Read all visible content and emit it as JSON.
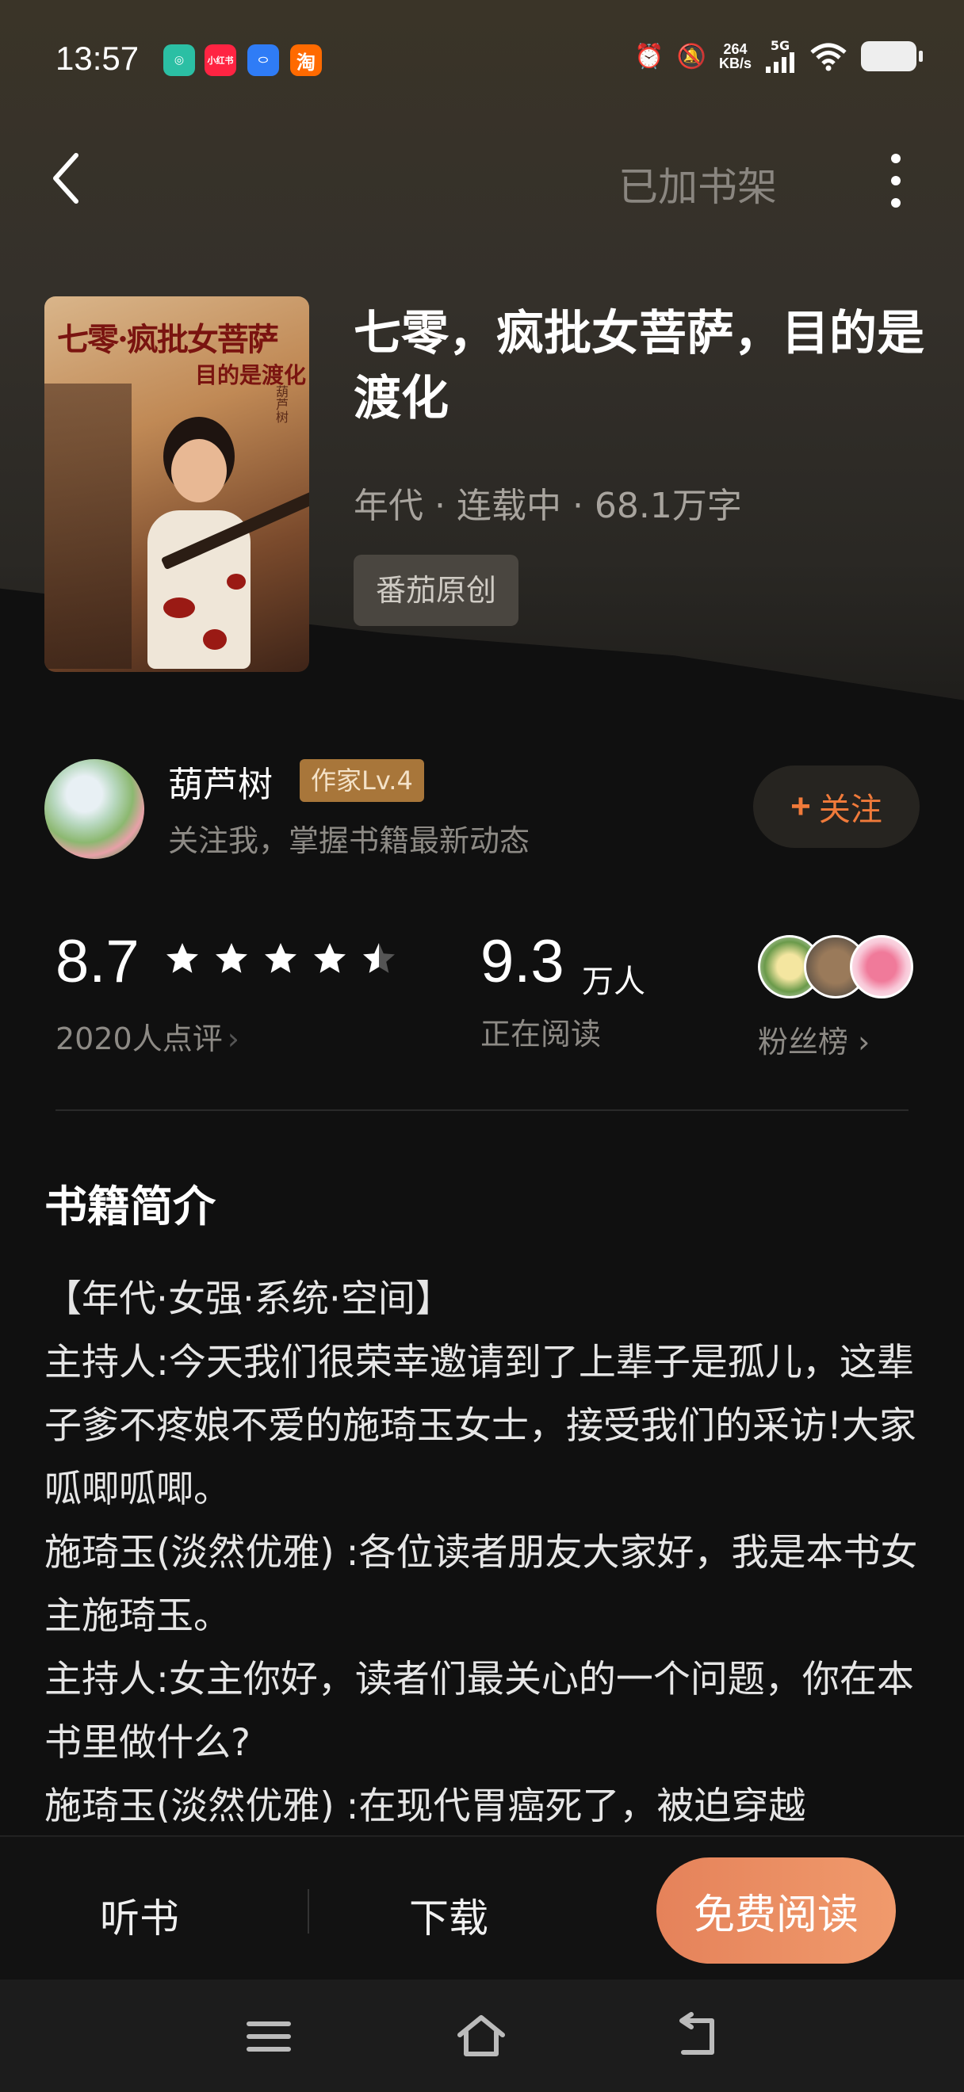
{
  "status_bar": {
    "time": "13:57",
    "apps": [
      "小红书",
      "淘"
    ],
    "net_speed_value": "264",
    "net_speed_unit": "KB/s",
    "network": "5G"
  },
  "nav": {
    "shelf_label": "已加书架"
  },
  "book": {
    "cover_title": "七零·疯批女菩萨",
    "cover_subtitle": "目的是渡化",
    "cover_author": "葫芦树",
    "title": "七零，疯批女菩萨，目的是渡化",
    "meta": "年代 · 连载中 · 68.1万字",
    "tag": "番茄原创"
  },
  "author": {
    "name": "葫芦树",
    "badge": "作家Lv.4",
    "subtitle": "关注我，掌握书籍最新动态",
    "follow_label": "关注"
  },
  "stats": {
    "rating": "8.7",
    "stars": 4.5,
    "rating_count": "2020人点评",
    "readers": "9.3",
    "readers_unit": "万人",
    "readers_label": "正在阅读",
    "fans_label": "粉丝榜"
  },
  "intro": {
    "title": "书籍简介",
    "lines": [
      "【年代·女强·系统·空间】",
      "主持人:今天我们很荣幸邀请到了上辈子是孤儿，这辈子爹不疼娘不爱的施琦玉女士，接受我们的采访!大家呱唧呱唧。",
      "施琦玉(淡然优雅) :各位读者朋友大家好，我是本书女主施琦玉。",
      "主持人:女主你好，读者们最关心的一个问题，你在本书里做什么?",
      "施琦玉(淡然优雅) :在现代胃癌死了，被迫穿越"
    ]
  },
  "bottom_bar": {
    "listen_label": "听书",
    "download_label": "下载",
    "read_label": "免费阅读"
  },
  "colors": {
    "accent": "#f07a3a",
    "read_button": "#e98a5f",
    "badge": "#a8763a"
  }
}
